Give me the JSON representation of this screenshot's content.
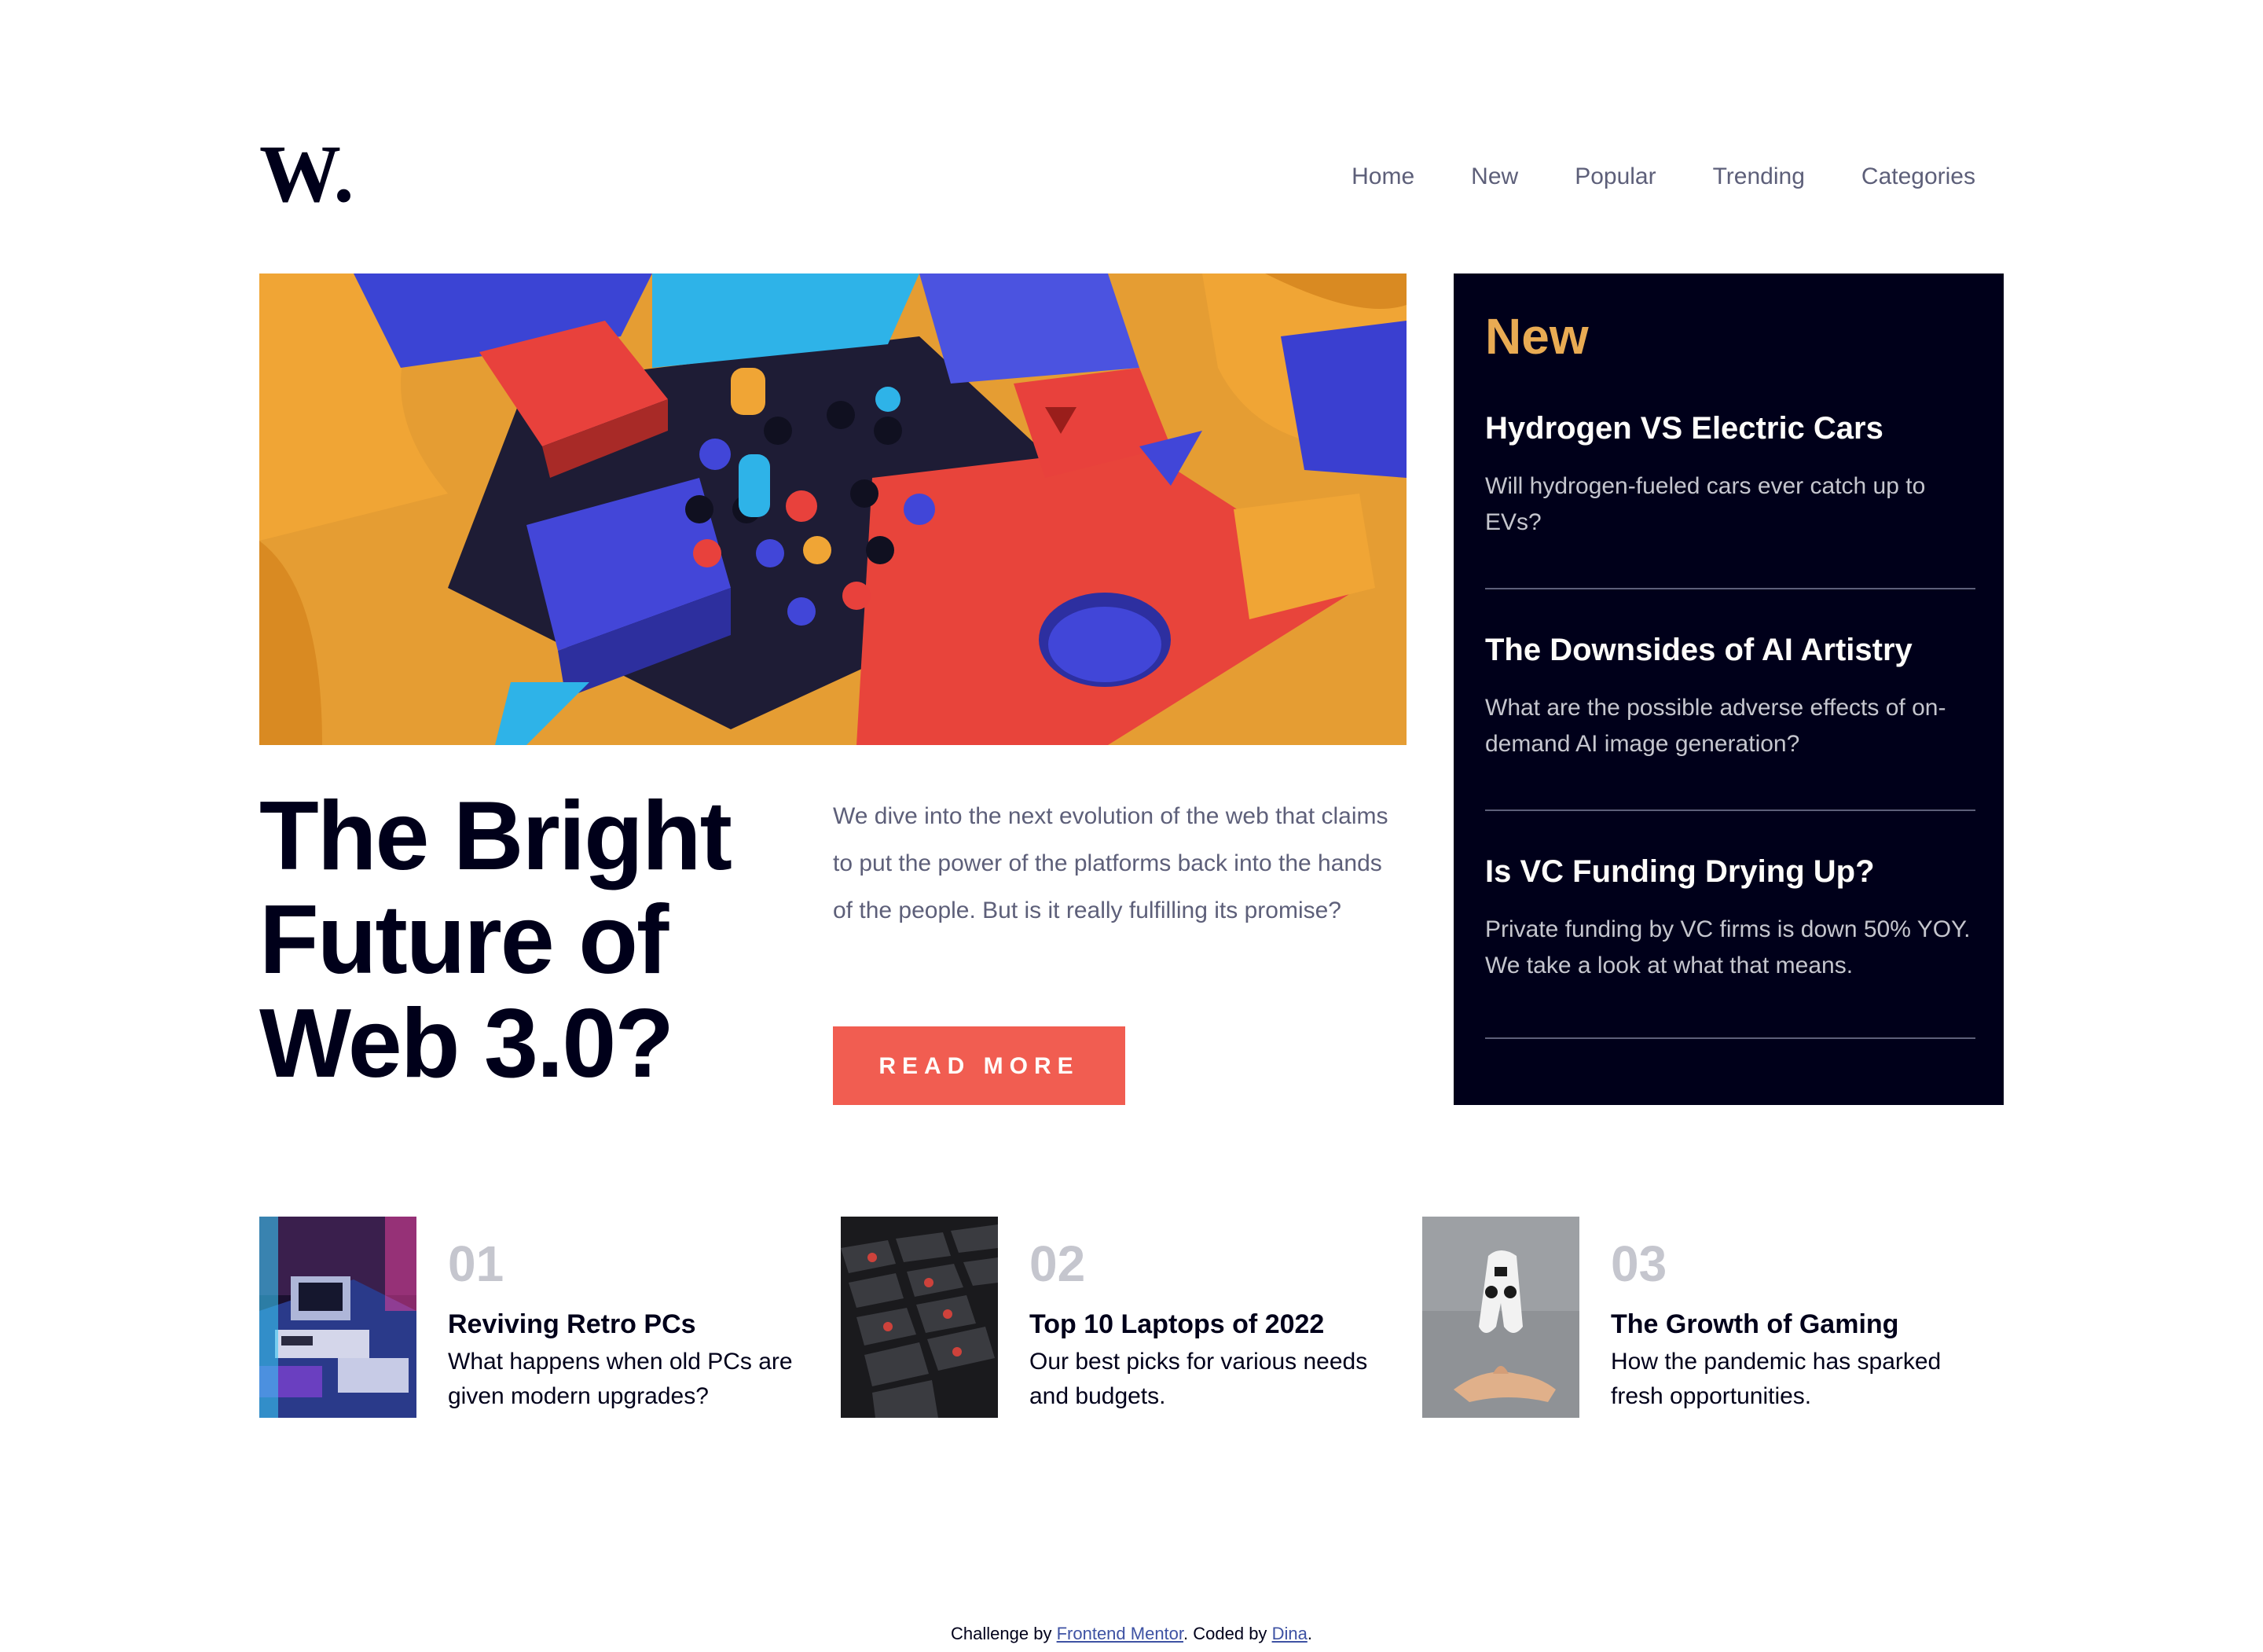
{
  "brand": {
    "logo_letter": "W."
  },
  "nav": {
    "items": [
      "Home",
      "New",
      "Popular",
      "Trending",
      "Categories"
    ]
  },
  "hero": {
    "title": "The Bright Future of Web 3.0?",
    "description": "We dive into the next evolution of the web that claims to put the power of the platforms back into the hands of the people. But is it really fulfilling its promise?",
    "cta_label": "READ MORE"
  },
  "new_panel": {
    "heading": "New",
    "items": [
      {
        "title": "Hydrogen VS Electric Cars",
        "description": "Will hydrogen-fueled cars ever catch up to EVs?"
      },
      {
        "title": "The Downsides of AI Artistry",
        "description": "What are the possible adverse effects of on-demand AI image generation?"
      },
      {
        "title": "Is VC Funding Drying Up?",
        "description": "Private funding by VC firms is down 50% YOY. We take a look at what that means."
      }
    ]
  },
  "cards": [
    {
      "number": "01",
      "title": "Reviving Retro PCs",
      "description": "What happens when old PCs are given modern upgrades?"
    },
    {
      "number": "02",
      "title": "Top 10 Laptops of 2022",
      "description": "Our best picks for various needs and budgets."
    },
    {
      "number": "03",
      "title": "The Growth of Gaming",
      "description": "How the pandemic has sparked fresh opportunities."
    }
  ],
  "attribution": {
    "prefix": "Challenge by",
    "link1": "Frontend Mentor",
    "middle": ". Coded by",
    "link2": "Dina",
    "suffix": "."
  },
  "colors": {
    "accent_orange": "#e9ab53",
    "accent_red": "#f15d51",
    "dark_navy": "#00001a",
    "grayish_blue": "#5d5f79",
    "off_white": "#fffdfa"
  }
}
